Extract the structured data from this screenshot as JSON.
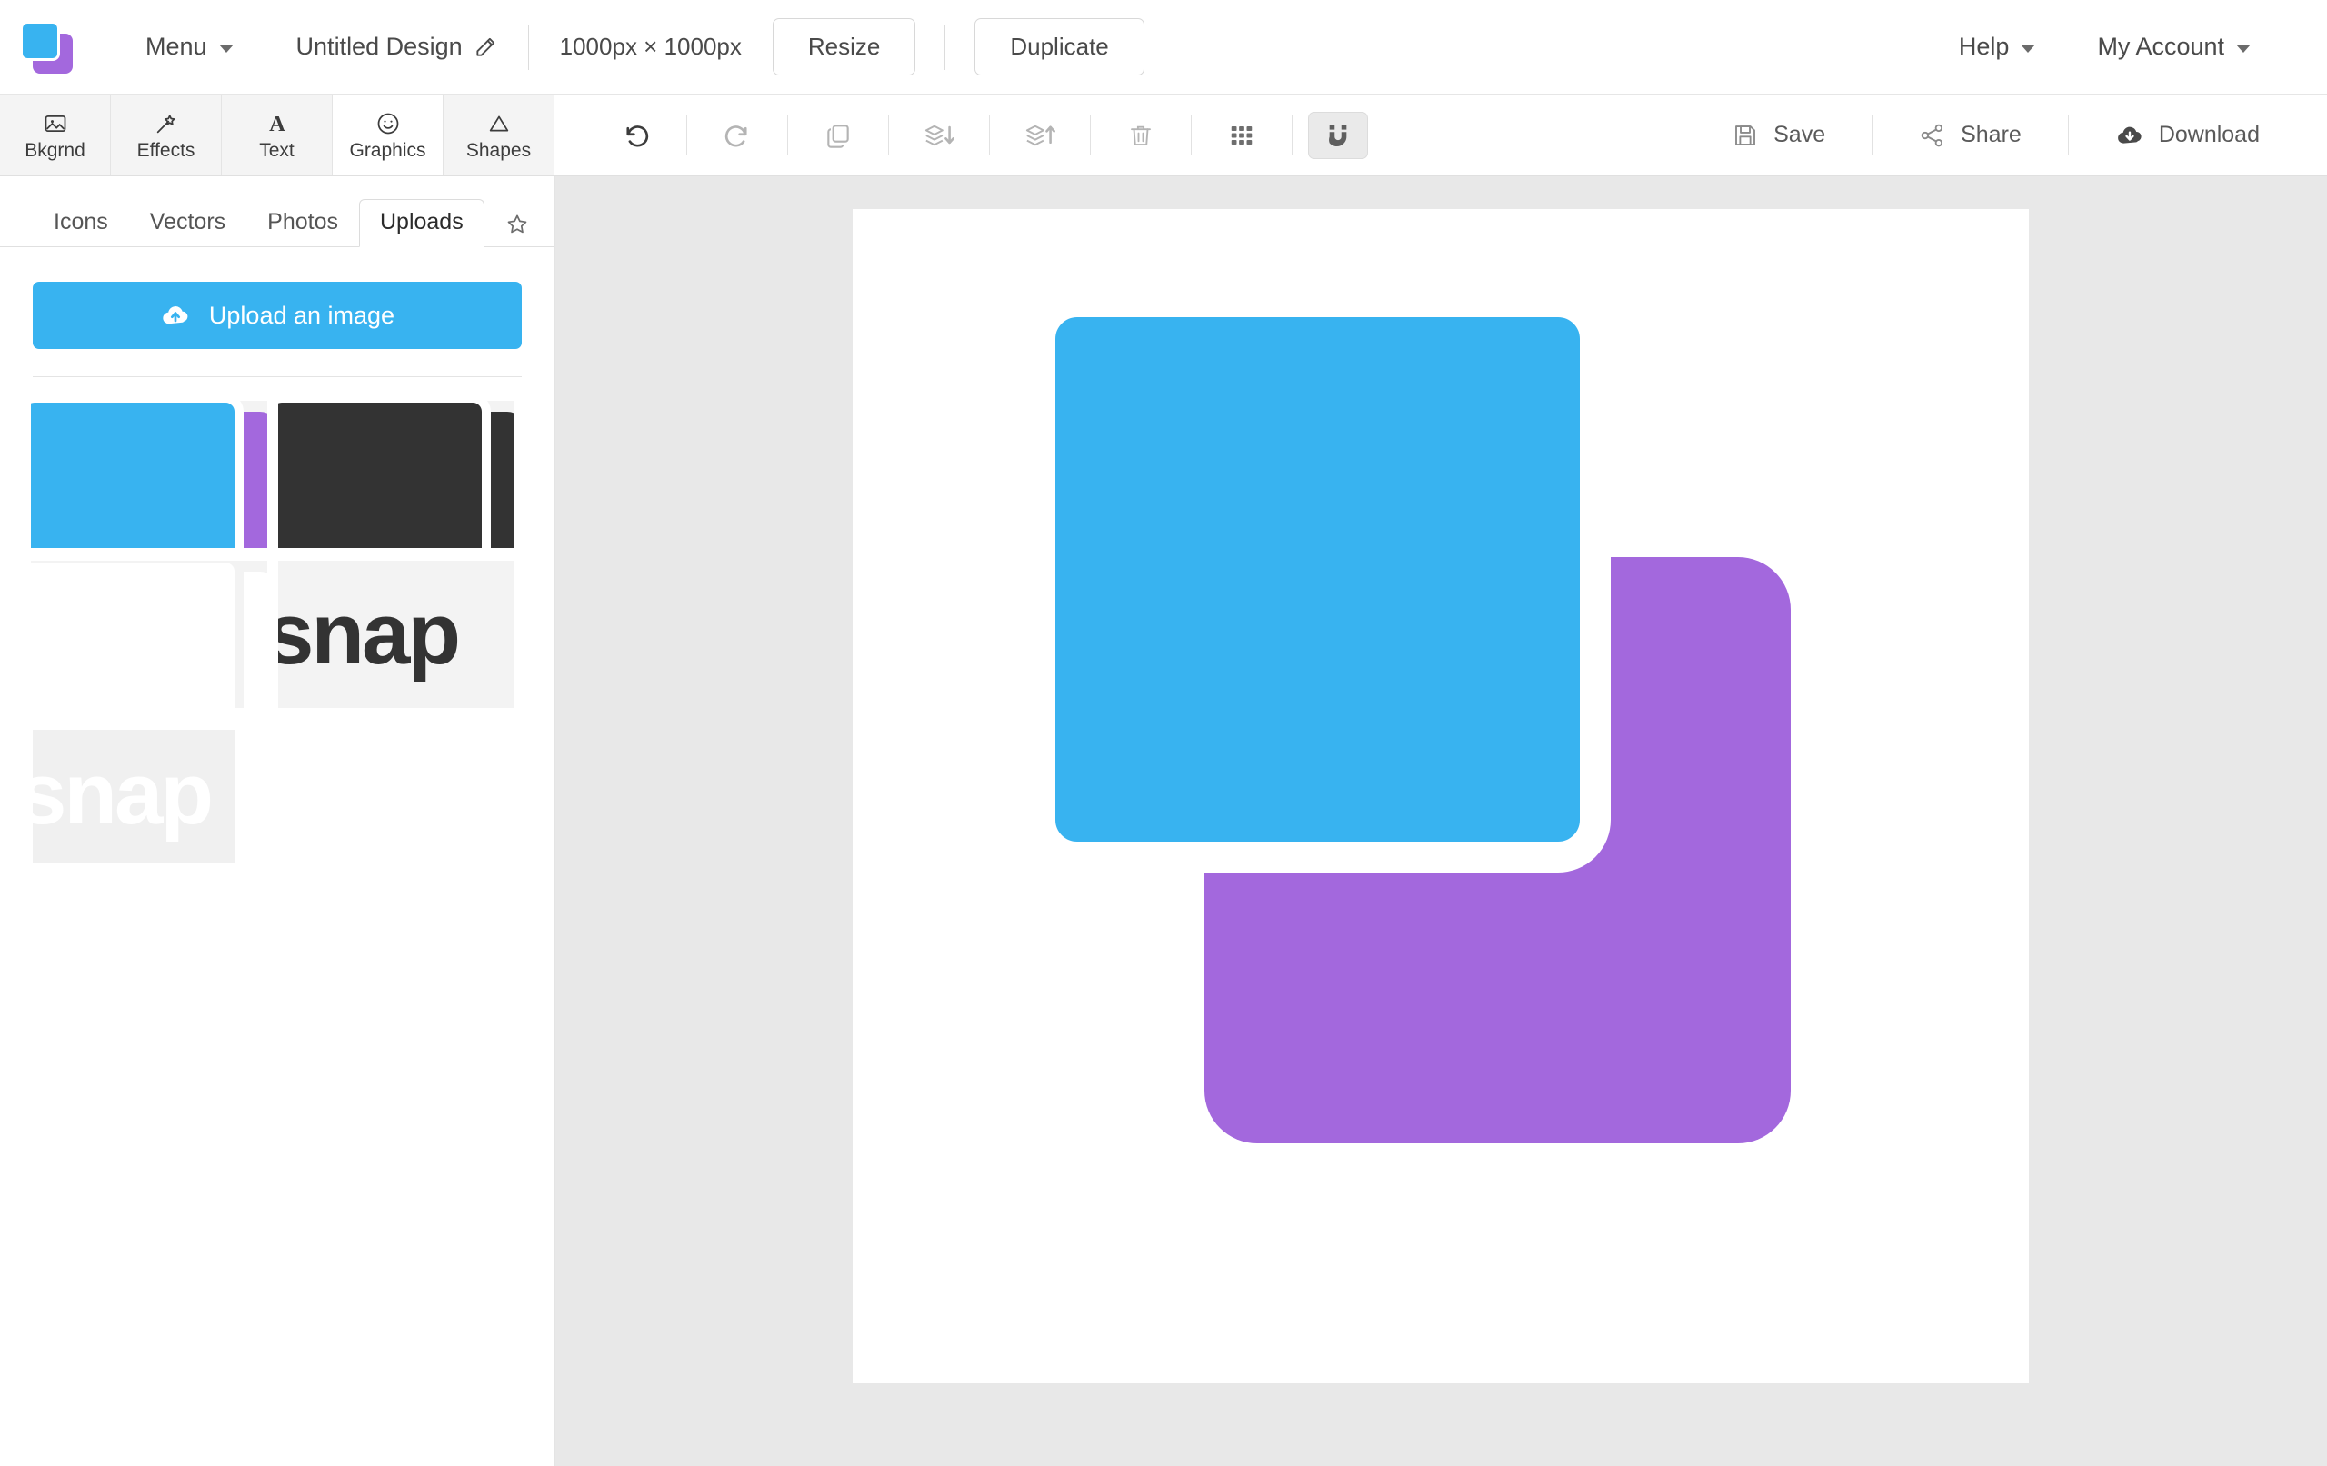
{
  "header": {
    "logo_name": "app-logo",
    "menu_label": "Menu",
    "design_title": "Untitled Design",
    "canvas_size_label": "1000px × 1000px",
    "resize_label": "Resize",
    "duplicate_label": "Duplicate",
    "help_label": "Help",
    "account_label": "My Account"
  },
  "toolbar": {
    "tool_tabs": [
      {
        "label": "Bkgrnd",
        "icon": "image-icon",
        "active": false
      },
      {
        "label": "Effects",
        "icon": "magic-wand-icon",
        "active": false
      },
      {
        "label": "Text",
        "icon": "text-a-icon",
        "active": false
      },
      {
        "label": "Graphics",
        "icon": "smiley-icon",
        "active": true
      },
      {
        "label": "Shapes",
        "icon": "triangle-icon",
        "active": false
      }
    ],
    "actions": [
      {
        "name": "undo-button",
        "icon": "undo-icon",
        "enabled": true
      },
      {
        "name": "redo-button",
        "icon": "redo-icon",
        "enabled": false
      },
      {
        "name": "duplicate-button",
        "icon": "copy-icon",
        "enabled": false
      },
      {
        "name": "send-backward-button",
        "icon": "layers-down-icon",
        "enabled": false
      },
      {
        "name": "bring-forward-button",
        "icon": "layers-up-icon",
        "enabled": false
      },
      {
        "name": "delete-button",
        "icon": "trash-icon",
        "enabled": false
      }
    ],
    "grid_toggle": {
      "name": "grid-toggle",
      "icon": "grid-icon",
      "on": false
    },
    "snap_toggle": {
      "name": "snap-toggle",
      "icon": "magnet-icon",
      "on": true
    },
    "save_label": "Save",
    "share_label": "Share",
    "download_label": "Download"
  },
  "sidebar": {
    "sub_tabs": [
      {
        "label": "Icons",
        "active": false
      },
      {
        "label": "Vectors",
        "active": false
      },
      {
        "label": "Photos",
        "active": false
      },
      {
        "label": "Uploads",
        "active": true
      }
    ],
    "favorites_icon": "star-icon",
    "upload_button_label": "Upload an image",
    "upload_button_icon": "cloud-upload-icon",
    "upload_button_color": "#38b3f0",
    "thumbnails": [
      {
        "name": "upload-thumb-logo-color",
        "kind": "squares-color",
        "alt": "blue and purple squares logo"
      },
      {
        "name": "upload-thumb-logo-dark",
        "kind": "squares-dark",
        "alt": "dark squares logo"
      },
      {
        "name": "upload-thumb-logo-white",
        "kind": "squares-white",
        "alt": "white squares logo"
      },
      {
        "name": "upload-thumb-wordmark-dark",
        "kind": "wordmark-dark",
        "text": "snap"
      },
      {
        "name": "upload-thumb-wordmark-white",
        "kind": "wordmark-white",
        "text": "snap"
      }
    ]
  },
  "canvas": {
    "background_color": "#ffffff",
    "workspace_color": "#e8e8e8",
    "shapes": [
      {
        "name": "purple-rounded-square",
        "color": "#a368dd",
        "corner_radius": 58
      },
      {
        "name": "blue-rounded-square",
        "color": "#38b3f0",
        "corner_radius": 58,
        "outline_color": "#ffffff"
      }
    ]
  }
}
